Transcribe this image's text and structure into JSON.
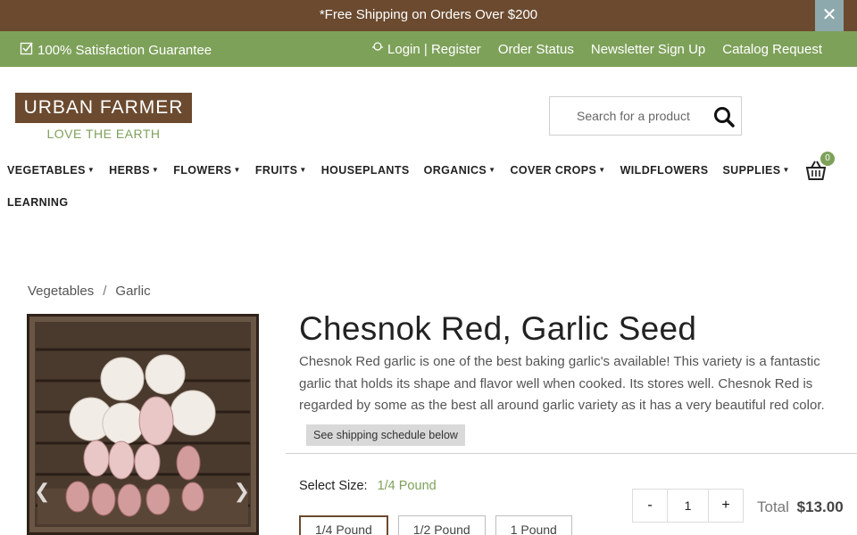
{
  "promo": {
    "text": "*Free Shipping on Orders Over $200",
    "close_label": "✕"
  },
  "util": {
    "guarantee": "100% Satisfaction Guarantee",
    "login": "Login | Register",
    "order_status": "Order Status",
    "newsletter": "Newsletter Sign Up",
    "catalog": "Catalog Request"
  },
  "logo": {
    "name": "URBAN FARMER",
    "tagline": "LOVE THE EARTH"
  },
  "search": {
    "placeholder": "Search for a product"
  },
  "nav": {
    "items": [
      {
        "label": "VEGETABLES",
        "caret": "▼"
      },
      {
        "label": "HERBS",
        "caret": "▼"
      },
      {
        "label": "FLOWERS",
        "caret": "▼"
      },
      {
        "label": "FRUITS",
        "caret": "▼"
      },
      {
        "label": "HOUSEPLANTS"
      },
      {
        "label": "ORGANICS",
        "caret": "▼"
      },
      {
        "label": "COVER CROPS",
        "caret": "▼"
      },
      {
        "label": "WILDFLOWERS"
      },
      {
        "label": "SUPPLIES",
        "caret": "▼"
      },
      {
        "label": "LEARNING"
      }
    ]
  },
  "cart": {
    "count": "0"
  },
  "breadcrumb": {
    "items": [
      "Vegetables",
      "Garlic"
    ],
    "separator": "/"
  },
  "product": {
    "title": "Chesnok Red, Garlic Seed",
    "description": "Chesnok Red garlic is one of the best baking garlic's available! This variety is a fantastic garlic that holds its shape and flavor well when cooked. Its stores well. Chesnok Red is regarded by some as the best all around garlic variety as it has a very beautiful red color.",
    "shipping_note": "See shipping schedule below",
    "size_label": "Select Size:",
    "size_selected": "1/4 Pound",
    "sizes": [
      "1/4 Pound",
      "1/2 Pound",
      "1 Pound"
    ],
    "quantity": "1",
    "qty_minus": "-",
    "qty_plus": "+",
    "total_label": "Total",
    "total_value": "$13.00"
  },
  "colors": {
    "brown": "#6b4a2f",
    "green": "#7ea15a",
    "close_bg": "#8ea9ad"
  }
}
